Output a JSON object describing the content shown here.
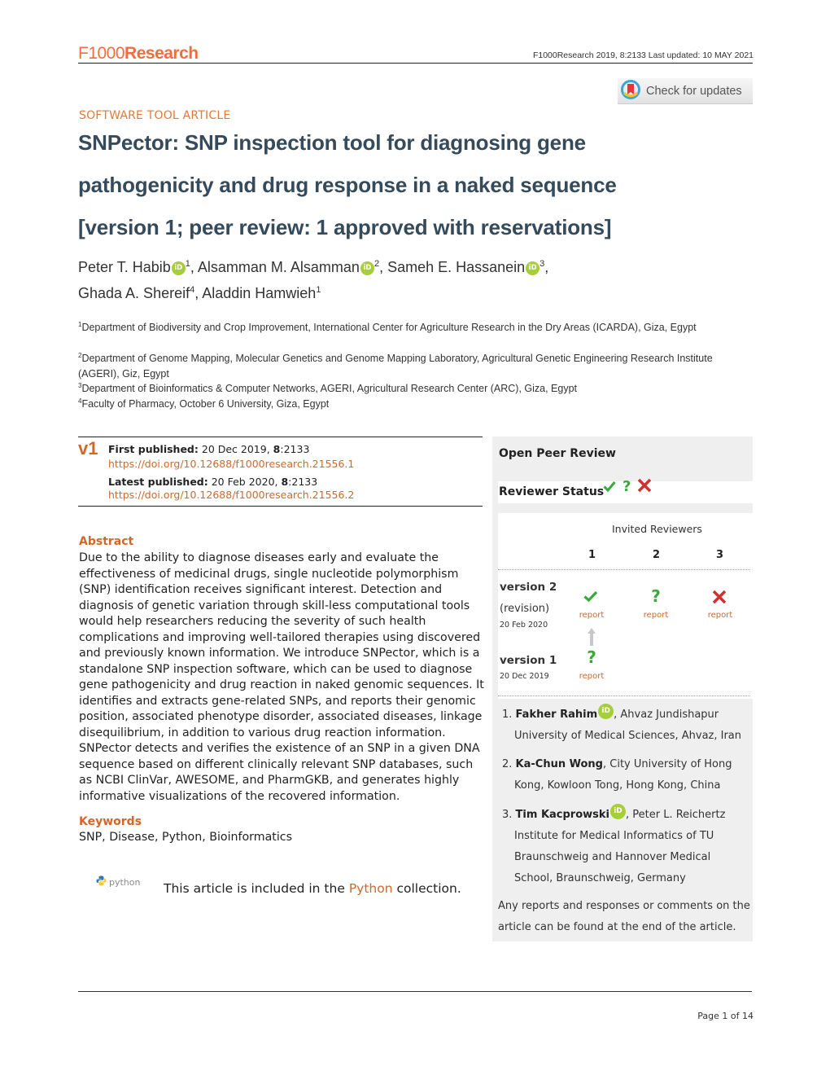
{
  "header": {
    "logo_prefix": "F1000",
    "logo_suffix": "Research",
    "meta": "F1000Research 2019, 8:2133 Last updated: 10 MAY 2021",
    "check_updates_label": "Check for updates"
  },
  "article": {
    "type": "SOFTWARE TOOL ARTICLE",
    "title_lines": [
      "SNPector: SNP inspection tool for diagnosing gene",
      "pathogenicity and drug response in a naked sequence",
      "[version 1; peer review: 1 approved with reservations]"
    ],
    "authors": [
      {
        "name": "Peter T. Habib",
        "aff": "1",
        "orcid": true
      },
      {
        "name": "Alsamman M. Alsamman",
        "aff": "2",
        "orcid": true
      },
      {
        "name": "Sameh E. Hassanein",
        "aff": "3",
        "orcid": true
      },
      {
        "name": "Ghada A. Shereif",
        "aff": "4",
        "orcid": false
      },
      {
        "name": "Aladdin Hamwieh",
        "aff": "1",
        "orcid": false
      }
    ],
    "orcid_label": "iD",
    "affiliations": [
      {
        "num": "1",
        "text": "Department of Biodiversity and Crop Improvement, International Center for Agriculture Research in the Dry Areas (ICARDA), Giza, Egypt"
      },
      {
        "num": "2",
        "text": "Department of Genome Mapping, Molecular Genetics and Genome Mapping Laboratory, Agricultural Genetic Engineering Research Institute (AGERI), Giz, Egypt"
      },
      {
        "num": "3",
        "text": "Department of Bioinformatics & Computer Networks, AGERI, Agricultural Research Center (ARC), Giza, Egypt"
      },
      {
        "num": "4",
        "text": "Faculty of Pharmacy, October 6 University, Giza, Egypt"
      }
    ]
  },
  "publication": {
    "version_badge": "v1",
    "first_label": "First published:",
    "first_date": " 20 Dec 2019, ",
    "first_vol": "8",
    "first_id": ":2133",
    "first_doi": "https://doi.org/10.12688/f1000research.21556.1",
    "latest_label": "Latest published:",
    "latest_date": " 20 Feb 2020, ",
    "latest_vol": "8",
    "latest_id": ":2133",
    "latest_doi": "https://doi.org/10.12688/f1000research.21556.2"
  },
  "abstract": {
    "heading": "Abstract",
    "text": "Due to the ability to diagnose diseases early and evaluate the effectiveness of medicinal drugs, single nucleotide polymorphism (SNP) identification receives significant interest. Detection and diagnosis of genetic variation through skill-less computational tools would help researchers reducing the severity of such health complications and improving well-tailored therapies using discovered and previously known information. We introduce SNPector, which is a standalone SNP inspection software, which can be used to diagnose gene pathogenicity and drug reaction in naked genomic sequences. It identifies and extracts gene-related SNPs, and reports their genomic position, associated phenotype disorder, associated diseases, linkage disequilibrium, in addition to various drug reaction information. SNPector detects and verifies the existence of an SNP in a given DNA sequence based on different clinically relevant SNP databases, such as NCBI ClinVar, AWESOME, and PharmGKB, and generates highly informative visualizations of the recovered information."
  },
  "keywords": {
    "heading": "Keywords",
    "text": "SNP, Disease, Python, Bioinformatics"
  },
  "collection": {
    "logo_text": "python",
    "prefix": "This article is included in the ",
    "link": "Python",
    "suffix": " collection."
  },
  "peer_review": {
    "title": "Open Peer Review",
    "status_title": "Reviewer Status",
    "colors": {
      "approved": "#3aa83a",
      "reservations": "#3aa83a",
      "rejected": "#d32f2f",
      "link": "#d2672a"
    },
    "invited_label": "Invited Reviewers",
    "columns": [
      "1",
      "2",
      "3"
    ],
    "versions": [
      {
        "label": "version 2",
        "sub": "(revision)",
        "date": "20 Feb 2020",
        "statuses": [
          "approved",
          "reservations",
          "rejected"
        ]
      },
      {
        "label": "version 1",
        "sub": "",
        "date": "20 Dec 2019",
        "statuses": [
          "reservations",
          "",
          ""
        ]
      }
    ],
    "report_label": "report",
    "reviewers": [
      {
        "num": "1.",
        "name": "Fakher Rahim",
        "orcid": true,
        "line1": ", Ahvaz Jundishapur",
        "rest": "University of Medical Sciences, Ahvaz, Iran"
      },
      {
        "num": "2.",
        "name": "Ka-Chun Wong",
        "orcid": false,
        "line1": ", City University of Hong",
        "rest": "Kong, Kowloon Tong, Hong Kong, China"
      },
      {
        "num": "3.",
        "name": "Tim Kacprowski",
        "orcid": true,
        "line1": ", Peter L. Reichertz",
        "rest": "Institute for Medical Informatics of TU Braunschweig and Hannover Medical School, Braunschweig, Germany"
      }
    ],
    "footer_note": "Any reports and responses or comments on the article can be found at the end of the article."
  },
  "footer": {
    "page": "Page 1 of 14"
  }
}
